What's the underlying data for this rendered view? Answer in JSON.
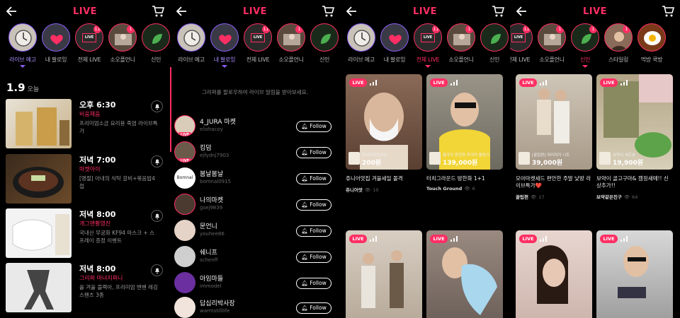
{
  "header": {
    "title": "LIVE"
  },
  "categories": {
    "p1": [
      "라이브 예고",
      "내 팔로잉",
      "전체 LIVE",
      "소오플언니",
      "신인"
    ],
    "p2": [
      "라이브 예고",
      "내 팔로잉",
      "전체 LIVE",
      "소오플언니",
      "신인"
    ],
    "p3": [
      "라이브 예고",
      "내 팔로잉",
      "전체 LIVE",
      "소오플언니",
      "신인"
    ],
    "p4": [
      "전체 LIVE",
      "소오플언니",
      "신인",
      "스타일링",
      "먹방 쿡방"
    ]
  },
  "schedule": {
    "date": "1.9",
    "date_sub": "오늘",
    "items": [
      {
        "time": "오후 6:30",
        "brand": "비움채움",
        "desc": "프리미엄소금 요리용 죽염 라이브특가"
      },
      {
        "time": "저녁 7:00",
        "brand": "마켓아이",
        "desc": "[명절] 아내의 식탁 갈비+볶음밥4첩"
      },
      {
        "time": "저녁 8:00",
        "brand": "개그맨황영진",
        "desc": "국내산 무궁화 KF94 마스크 + 스프레이 증정 이벤트"
      },
      {
        "time": "저녁 8:00",
        "brand": "그리퍼 마녀지퍼니",
        "desc": "올 겨울 블랙아, 프리미엄 밴벤 레깅스팬츠 3종"
      }
    ]
  },
  "following": {
    "notice": "그리퍼를 팔로우하여 라이브 알림을 받아보세요.",
    "follow_label": "Follow",
    "rows": [
      {
        "name": "4_JURA 마켓",
        "handle": "elishacoy",
        "live": true
      },
      {
        "name": "킹덤",
        "handle": "ejfydnj7903",
        "live": true
      },
      {
        "name": "봄날봄날",
        "handle": "bomnal0915",
        "live": false
      },
      {
        "name": "나의마켓",
        "handle": "gsej9839",
        "live": false
      },
      {
        "name": "문언니",
        "handle": "youhee86",
        "live": false
      },
      {
        "name": "쉐니프",
        "handle": "schenff",
        "live": false
      },
      {
        "name": "아임마들",
        "handle": "immodel",
        "live": false
      },
      {
        "name": "답십리박사장",
        "handle": "warmstilllife",
        "live": false
      }
    ]
  },
  "live_label": "LIVE",
  "grid_all": [
    {
      "title": "쥬니어앗집 겨울세일 몰격",
      "host": "쥬니어앗",
      "views": "10",
      "product": "하세사라장200",
      "price": "200원"
    },
    {
      "title": "터치그라운드 방한화 1+1",
      "host": "Touch Ground",
      "views": "6",
      "product": "올라잇 방한화 투이머 롤림거",
      "price": "139,000원"
    },
    {
      "title": "",
      "host": "",
      "views": "",
      "product": "",
      "price": ""
    },
    {
      "title": "",
      "host": "",
      "views": "",
      "product": "",
      "price": ""
    }
  ],
  "grid_new": [
    {
      "title": "모아마켓세드 편안한 주말 낮방 라이브특가❤️",
      "host": "꿀팁편",
      "views": "17",
      "product": "[꿀팁편] 여리여지 니트",
      "price": "39,000원"
    },
    {
      "title": "보약이 골고구마& 캠핑새떼!! 신상추가!!",
      "host": "보약같은친구",
      "views": "64",
      "product": "보약이 세트효",
      "price": "19,900원"
    },
    {
      "title": "",
      "host": "",
      "views": "",
      "product": "",
      "price": ""
    },
    {
      "title": "",
      "host": "",
      "views": "",
      "product": "",
      "price": ""
    }
  ],
  "colors": {
    "accent": "#ff2e63",
    "purple": "#8b5cf6"
  }
}
